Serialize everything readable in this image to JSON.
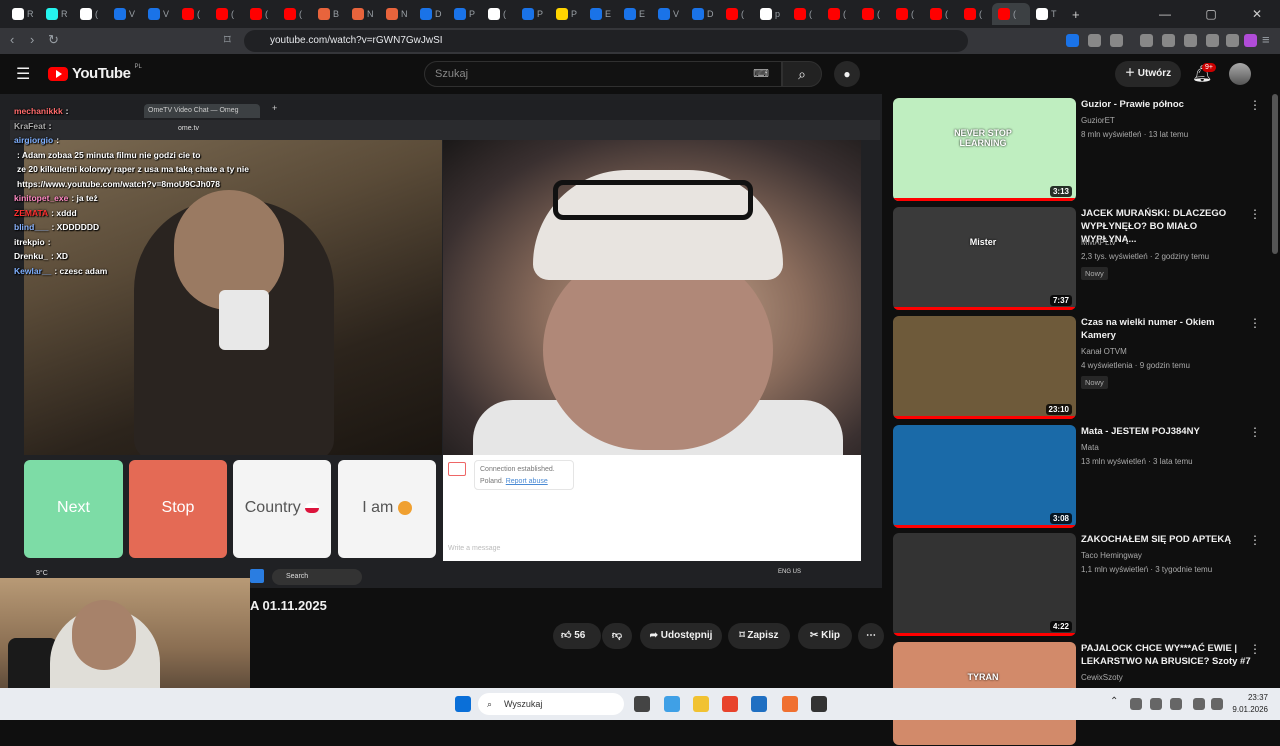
{
  "browser": {
    "tabs": [
      {
        "label": "R",
        "color": "#ffffff"
      },
      {
        "label": "R",
        "color": "#25f4ee"
      },
      {
        "label": "(",
        "color": "#ffffff"
      },
      {
        "label": "V",
        "color": "#1a73e8"
      },
      {
        "label": "V",
        "color": "#1a73e8"
      },
      {
        "label": "(",
        "color": "#ff0000"
      },
      {
        "label": "(",
        "color": "#ff0000"
      },
      {
        "label": "(",
        "color": "#ff0000"
      },
      {
        "label": "(",
        "color": "#ff0000"
      },
      {
        "label": "B",
        "color": "#e8643c"
      },
      {
        "label": "N",
        "color": "#e8643c"
      },
      {
        "label": "N",
        "color": "#e8643c"
      },
      {
        "label": "D",
        "color": "#1a73e8"
      },
      {
        "label": "P",
        "color": "#1a73e8"
      },
      {
        "label": "(",
        "color": "#ffffff"
      },
      {
        "label": "P",
        "color": "#1a73e8"
      },
      {
        "label": "P",
        "color": "#ffd400"
      },
      {
        "label": "E",
        "color": "#1a73e8"
      },
      {
        "label": "E",
        "color": "#1a73e8"
      },
      {
        "label": "V",
        "color": "#1a73e8"
      },
      {
        "label": "D",
        "color": "#1a73e8"
      },
      {
        "label": "(",
        "color": "#ff0000"
      },
      {
        "label": "p",
        "color": "#ffffff"
      },
      {
        "label": "(",
        "color": "#ff0000"
      },
      {
        "label": "(",
        "color": "#ff0000"
      },
      {
        "label": "(",
        "color": "#ff0000"
      },
      {
        "label": "(",
        "color": "#ff0000"
      },
      {
        "label": "(",
        "color": "#ff0000"
      },
      {
        "label": "(",
        "color": "#ff0000"
      },
      {
        "label": "(",
        "color": "#ff0000"
      },
      {
        "label": "T",
        "color": "#ffffff"
      }
    ],
    "url": "youtube.com/watch?v=rGWN7GwJwSI",
    "window_controls": [
      "—",
      "▢",
      "✕"
    ]
  },
  "youtube": {
    "logo_text": "YouTube",
    "region": "PL",
    "search_placeholder": "Szukaj",
    "create_label": "Utwórz",
    "notification_count": "9+",
    "video_title": "A 01.11.2025",
    "like_count": "56",
    "share_label": "Udostępnij",
    "save_label": "Zapisz",
    "clip_label": "Klip"
  },
  "stream": {
    "inner_tab": "OmeTV Video Chat — Omeg",
    "inner_url": "ome.tv",
    "chat": [
      {
        "user": "mechanikkk",
        "text": ":",
        "color": "#ff6b6b"
      },
      {
        "user": "KraFeat",
        "text": ":",
        "color": "#aaaaaa"
      },
      {
        "user": "airgiorgio",
        "text": ":",
        "color": "#7fb0ff"
      },
      {
        "user": "",
        "text": ": Adam zobaa 25 minuta filmu nie godzi cie to",
        "color": "#5fcf5f"
      },
      {
        "user": "",
        "text": "ze 20 kilkuletni kolorwy raper z usa ma taką chate a ty nie",
        "color": "#ffffff"
      },
      {
        "user": "",
        "text": "https://www.youtube.com/watch?v=8moU9CJh078",
        "color": "#ffffff"
      },
      {
        "user": "kinitopet_exe",
        "text": ": ja też",
        "color": "#ff8ac4"
      },
      {
        "user": "ZEMATA",
        "text": ": xddd",
        "color": "#ff3030"
      },
      {
        "user": "blind___",
        "text": ": XDDDDDD",
        "color": "#8ab4ff"
      },
      {
        "user": "itrekpio",
        "text": ":",
        "color": "#ffffff"
      },
      {
        "user": "Drenku_",
        "text": ": XD",
        "color": "#ffffff"
      },
      {
        "user": "Kewlar__",
        "text": ": czesc adam",
        "color": "#7fb0ff"
      }
    ],
    "buttons": {
      "next": "Next",
      "stop": "Stop",
      "country": "Country",
      "iam": "I am"
    },
    "connection": "Connection established.",
    "country_name": "Poland.",
    "report": "Report abuse",
    "write_placeholder": "Write a message",
    "inner_taskbar_search": "Search",
    "inner_weather": "9°C",
    "inner_lang": "ENG US"
  },
  "recommendations": [
    {
      "title": "Guzior - Prawie północ",
      "channel": "GuziorET",
      "meta": "8 mln wyświetleń · 13 lat temu",
      "duration": "3:13",
      "badge": "",
      "thumb_text": "NEVER STOP LEARNING",
      "bg": "#bfeec0"
    },
    {
      "title": "JACEK MURAŃSKI: DLACZEGO WYPŁYNĘŁO? BO MIAŁO WYPŁYNĄ...",
      "channel": "MMAPLtv",
      "meta": "2,3 tys. wyświetleń · 2 godziny temu",
      "duration": "7:37",
      "badge": "Nowy",
      "thumb_text": "Mister",
      "bg": "#3a3a3a"
    },
    {
      "title": "Czas na wielki numer -  Okiem Kamery",
      "channel": "Kanał OTVM",
      "meta": "4 wyświetlenia · 9 godzin temu",
      "duration": "23:10",
      "badge": "Nowy",
      "thumb_text": "",
      "bg": "#6e5a3a"
    },
    {
      "title": "Mata - JESTEM POJ384NY",
      "channel": "Mata",
      "meta": "13 mln wyświetleń · 3 lata temu",
      "duration": "3:08",
      "badge": "",
      "thumb_text": "",
      "bg": "#1a6aa8"
    },
    {
      "title": "ZAKOCHAŁEM SIĘ POD APTEKĄ",
      "channel": "Taco Hemingway",
      "meta": "1,1 mln wyświetleń · 3 tygodnie temu",
      "duration": "4:22",
      "badge": "",
      "thumb_text": "",
      "bg": "#333333"
    },
    {
      "title": "PAJALOCK CHCE WY***AĆ EWIE | LEKARSTWO NA BRUSICE? Szoty #7",
      "channel": "CewixSzoty",
      "meta": "",
      "duration": "",
      "badge": "",
      "thumb_text": "TYRAN",
      "bg": "#d28a6a"
    }
  ],
  "taskbar": {
    "search_label": "Wyszukaj",
    "time": "23:37",
    "date": "9.01.2026"
  }
}
